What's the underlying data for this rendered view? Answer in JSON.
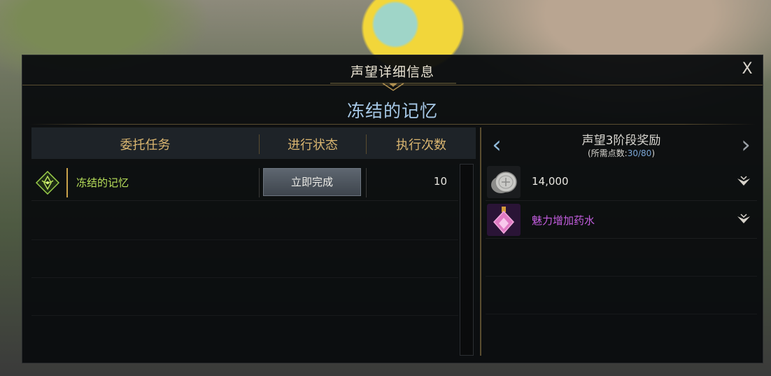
{
  "dialog": {
    "title": "声望详细信息",
    "close_label": "X",
    "subtitle": "冻结的记忆"
  },
  "quests": {
    "headers": {
      "task": "委托任务",
      "status": "进行状态",
      "count": "执行次数"
    },
    "rows": [
      {
        "name": "冻结的记忆",
        "action": "立即完成",
        "count": "10",
        "icon": "quest-emblem-icon"
      }
    ]
  },
  "rewards": {
    "title": "声望3阶段奖励",
    "points_prefix": "(所需点数:",
    "points_value": "30/80",
    "points_suffix": ")",
    "prev_icon": "chevron-left-icon",
    "next_icon": "chevron-right-icon",
    "items": [
      {
        "label": "14,000",
        "icon": "silver-coin-icon",
        "color": "#e8e6e0"
      },
      {
        "label": "魅力增加药水",
        "icon": "potion-icon",
        "color": "#c45ee0"
      }
    ]
  },
  "colors": {
    "accent_gold": "#d9b570",
    "subtitle_blue": "#a6c8e6",
    "quest_green": "#b8e05a",
    "reward_purple": "#c45ee0"
  }
}
